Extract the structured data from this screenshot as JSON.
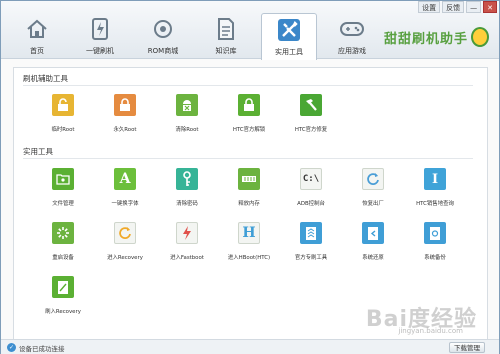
{
  "window_controls": {
    "settings": "设置",
    "feedback": "反馈",
    "minimize": "—",
    "close": "✕"
  },
  "nav": [
    {
      "label": "首页",
      "icon": "home-icon",
      "active": false
    },
    {
      "label": "一键刷机",
      "icon": "flash-icon",
      "active": false
    },
    {
      "label": "ROM商城",
      "icon": "rom-store-icon",
      "active": false
    },
    {
      "label": "知识库",
      "icon": "document-icon",
      "active": false
    },
    {
      "label": "实用工具",
      "icon": "tools-icon",
      "active": true
    },
    {
      "label": "应用游戏",
      "icon": "gamepad-icon",
      "active": false
    }
  ],
  "brand": {
    "text": "甜甜刷机助手"
  },
  "sections": {
    "flash_tools": "刷机辅助工具",
    "utilities": "实用工具"
  },
  "flash_tools": [
    {
      "label": "临时Root",
      "icon": "unlock-temp-icon",
      "color": "#e7b533"
    },
    {
      "label": "永久Root",
      "icon": "lock-permanent-icon",
      "color": "#e58b40"
    },
    {
      "label": "清除Root",
      "icon": "android-clear-icon",
      "color": "#6cb33f"
    },
    {
      "label": "HTC官方解锁",
      "icon": "unlock-htc-icon",
      "color": "#5bb033"
    },
    {
      "label": "HTC官方修复",
      "icon": "hammer-icon",
      "color": "#4aa734"
    }
  ],
  "utilities": [
    {
      "label": "文件管理",
      "icon": "folder-icon",
      "color": "#5bb033"
    },
    {
      "label": "一键换字体",
      "icon": "font-icon",
      "color": "#6cbf3b"
    },
    {
      "label": "清除密码",
      "icon": "key-icon",
      "color": "#36b497"
    },
    {
      "label": "释放内存",
      "icon": "memory-icon",
      "color": "#6cb33f"
    },
    {
      "label": "ADB控制台",
      "icon": "console-icon",
      "color": "#f2f4f1"
    },
    {
      "label": "恢复出厂",
      "icon": "restore-icon",
      "color": "#4a9ed6"
    },
    {
      "label": "HTC销售地查询",
      "icon": "info-icon",
      "color": "#3fa3d8"
    },
    {
      "label": "重启设备",
      "icon": "reboot-icon",
      "color": "#6cb33f"
    },
    {
      "label": "进入Recovery",
      "icon": "refresh-icon",
      "color": "#f0a92a"
    },
    {
      "label": "进入Fastboot",
      "icon": "lightning-icon",
      "color": "#e0504a"
    },
    {
      "label": "进入HBoot(HTC)",
      "icon": "hboot-icon",
      "color": "#3f9ed6"
    },
    {
      "label": "官方专刷工具",
      "icon": "flash-tool-icon",
      "color": "#3f9ed6"
    },
    {
      "label": "系统还原",
      "icon": "system-restore-icon",
      "color": "#3f9ed6"
    },
    {
      "label": "系统备份",
      "icon": "system-backup-icon",
      "color": "#3f9ed6"
    },
    {
      "label": "刷入Recovery",
      "icon": "recovery-flash-icon",
      "color": "#5bb033"
    }
  ],
  "status": {
    "ok_mark": "✓",
    "text": "设备已成功连接"
  },
  "download_manager": "下载管理",
  "watermark": {
    "main": "Bai度经验",
    "sub": "jingyan.baidu.com"
  }
}
